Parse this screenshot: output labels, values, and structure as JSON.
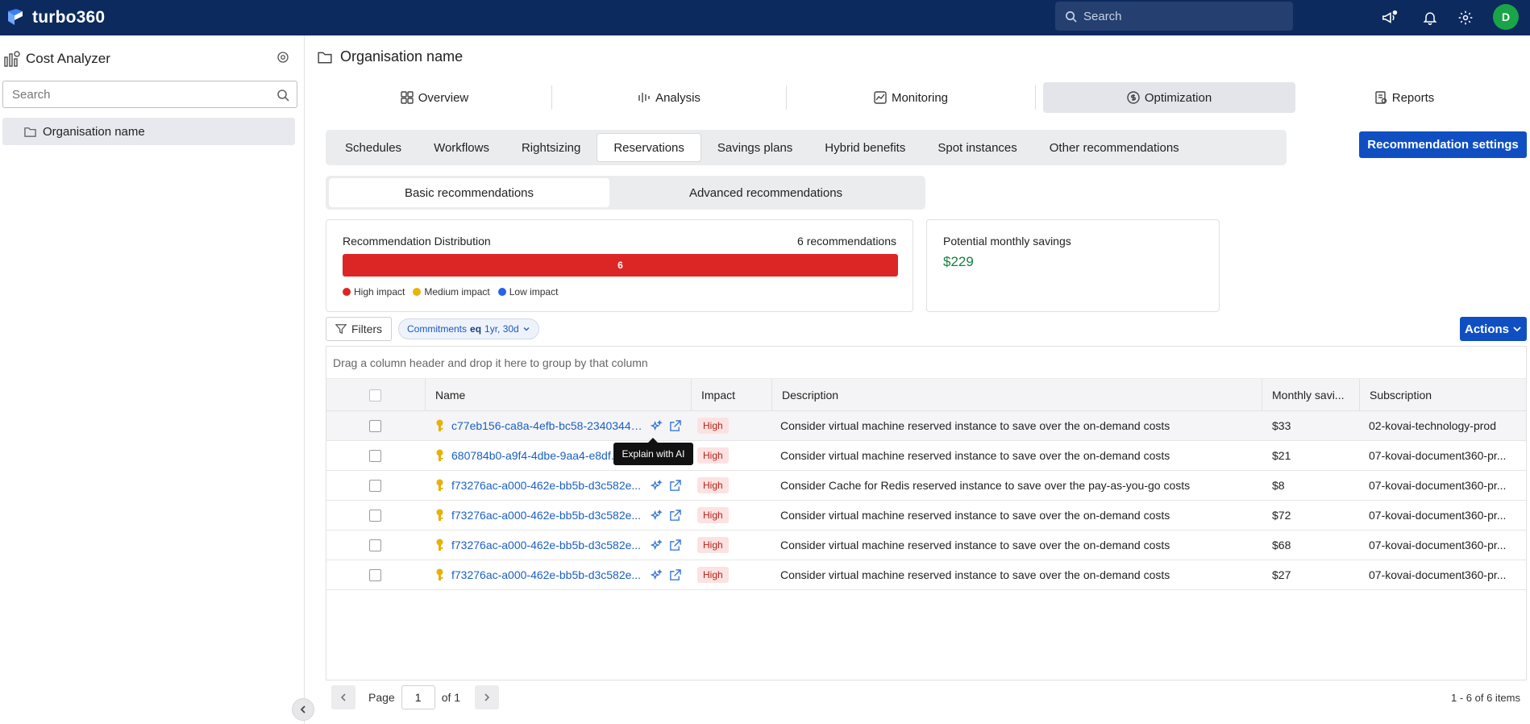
{
  "app": {
    "brand": "turbo360",
    "search_placeholder": "Search",
    "user_initial": "D"
  },
  "sidebar": {
    "title": "Cost Analyzer",
    "search_placeholder": "Search",
    "items": [
      {
        "label": "Organisation name"
      }
    ]
  },
  "main": {
    "title": "Organisation name",
    "tabs": [
      {
        "label": "Overview"
      },
      {
        "label": "Analysis"
      },
      {
        "label": "Monitoring"
      },
      {
        "label": "Optimization"
      },
      {
        "label": "Reports"
      }
    ],
    "subtabs": [
      {
        "label": "Schedules"
      },
      {
        "label": "Workflows"
      },
      {
        "label": "Rightsizing"
      },
      {
        "label": "Reservations"
      },
      {
        "label": "Savings plans"
      },
      {
        "label": "Hybrid benefits"
      },
      {
        "label": "Spot instances"
      },
      {
        "label": "Other recommendations"
      }
    ],
    "recommendation_settings_label": "Recommendation settings",
    "rec_types": [
      {
        "label": "Basic recommendations"
      },
      {
        "label": "Advanced recommendations"
      }
    ]
  },
  "distribution": {
    "title": "Recommendation Distribution",
    "count_label": "6 recommendations",
    "bar_value": "6",
    "high_fraction": 1.0,
    "legend": [
      {
        "label": "High impact",
        "color": "#dc2626"
      },
      {
        "label": "Medium impact",
        "color": "#eab308"
      },
      {
        "label": "Low impact",
        "color": "#2563eb"
      }
    ]
  },
  "savings": {
    "title": "Potential monthly savings",
    "value": "$229"
  },
  "toolbar": {
    "filters_label": "Filters",
    "chip_field": "Commitments",
    "chip_op": "eq",
    "chip_value": "1yr, 30d",
    "actions_label": "Actions"
  },
  "grid": {
    "group_hint": "Drag a column header and drop it here to group by that column",
    "columns": {
      "name": "Name",
      "impact": "Impact",
      "description": "Description",
      "savings": "Monthly savi...",
      "subscription": "Subscription"
    },
    "rows": [
      {
        "name": "c77eb156-ca8a-4efb-bc58-23403449...",
        "impact": "High",
        "description": "Consider virtual machine reserved instance to save over the on-demand costs",
        "savings": "$33",
        "subscription": "02-kovai-technology-prod"
      },
      {
        "name": "680784b0-a9f4-4dbe-9aa4-e8df...",
        "impact": "High",
        "description": "Consider virtual machine reserved instance to save over the on-demand costs",
        "savings": "$21",
        "subscription": "07-kovai-document360-pr..."
      },
      {
        "name": "f73276ac-a000-462e-bb5b-d3c582e...",
        "impact": "High",
        "description": "Consider Cache for Redis reserved instance to save over the pay-as-you-go costs",
        "savings": "$8",
        "subscription": "07-kovai-document360-pr..."
      },
      {
        "name": "f73276ac-a000-462e-bb5b-d3c582e...",
        "impact": "High",
        "description": "Consider virtual machine reserved instance to save over the on-demand costs",
        "savings": "$72",
        "subscription": "07-kovai-document360-pr..."
      },
      {
        "name": "f73276ac-a000-462e-bb5b-d3c582e...",
        "impact": "High",
        "description": "Consider virtual machine reserved instance to save over the on-demand costs",
        "savings": "$68",
        "subscription": "07-kovai-document360-pr..."
      },
      {
        "name": "f73276ac-a000-462e-bb5b-d3c582e...",
        "impact": "High",
        "description": "Consider virtual machine reserved instance to save over the on-demand costs",
        "savings": "$27",
        "subscription": "07-kovai-document360-pr..."
      }
    ]
  },
  "tooltip": {
    "text": "Explain with AI"
  },
  "pager": {
    "page_label": "Page",
    "page_value": "1",
    "of_label": "of 1",
    "info": "1 - 6 of 6 items"
  }
}
